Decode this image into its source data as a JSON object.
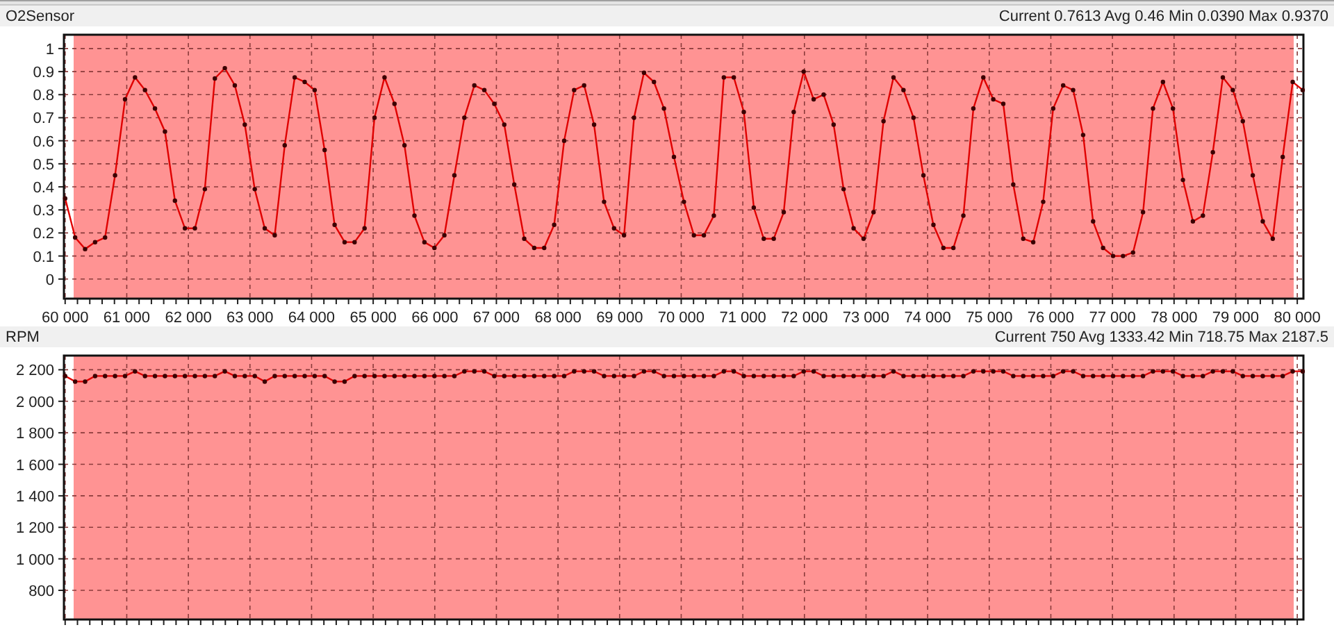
{
  "panels": [
    {
      "title": "O2Sensor",
      "stats": "Current 0.7613 Avg 0.46 Min 0.0390 Max 0.9370",
      "chart_data": {
        "type": "line",
        "grid": true,
        "x": [
          60000,
          60162,
          60324,
          60486,
          60648,
          60810,
          60972,
          61134,
          61296,
          61458,
          61620,
          61782,
          61944,
          62106,
          62268,
          62430,
          62592,
          62754,
          62916,
          63078,
          63240,
          63402,
          63564,
          63726,
          63888,
          64050,
          64212,
          64374,
          64536,
          64698,
          64860,
          65022,
          65184,
          65346,
          65508,
          65670,
          65832,
          65994,
          66156,
          66318,
          66480,
          66642,
          66804,
          66966,
          67128,
          67290,
          67452,
          67614,
          67776,
          67938,
          68100,
          68262,
          68424,
          68586,
          68748,
          68910,
          69072,
          69234,
          69396,
          69558,
          69720,
          69882,
          70044,
          70206,
          70368,
          70530,
          70692,
          70854,
          71016,
          71178,
          71340,
          71502,
          71664,
          71826,
          71988,
          72150,
          72312,
          72474,
          72636,
          72798,
          72960,
          73122,
          73284,
          73446,
          73608,
          73770,
          73932,
          74094,
          74256,
          74418,
          74580,
          74742,
          74904,
          75066,
          75228,
          75390,
          75552,
          75714,
          75876,
          76038,
          76200,
          76362,
          76524,
          76686,
          76848,
          77010,
          77172,
          77334,
          77496,
          77658,
          77820,
          77982,
          78144,
          78306,
          78468,
          78630,
          78792,
          78954,
          79116,
          79278,
          79440,
          79602,
          79764,
          79926,
          80088
        ],
        "series": [
          {
            "color": "#e00000",
            "marker": true,
            "values": [
              0.35,
              0.18,
              0.13,
              0.16,
              0.18,
              0.45,
              0.78,
              0.875,
              0.82,
              0.74,
              0.64,
              0.34,
              0.22,
              0.22,
              0.39,
              0.87,
              0.915,
              0.84,
              0.67,
              0.39,
              0.22,
              0.19,
              0.58,
              0.875,
              0.855,
              0.82,
              0.56,
              0.235,
              0.16,
              0.16,
              0.22,
              0.7,
              0.875,
              0.76,
              0.58,
              0.275,
              0.16,
              0.135,
              0.19,
              0.45,
              0.7,
              0.84,
              0.82,
              0.76,
              0.67,
              0.41,
              0.175,
              0.135,
              0.135,
              0.235,
              0.6,
              0.82,
              0.84,
              0.67,
              0.335,
              0.22,
              0.19,
              0.7,
              0.895,
              0.855,
              0.74,
              0.53,
              0.335,
              0.19,
              0.19,
              0.275,
              0.875,
              0.875,
              0.725,
              0.31,
              0.175,
              0.175,
              0.29,
              0.725,
              0.9,
              0.78,
              0.8,
              0.67,
              0.39,
              0.22,
              0.175,
              0.29,
              0.685,
              0.875,
              0.82,
              0.7,
              0.45,
              0.235,
              0.135,
              0.135,
              0.275,
              0.74,
              0.875,
              0.78,
              0.76,
              0.41,
              0.175,
              0.16,
              0.335,
              0.74,
              0.84,
              0.82,
              0.625,
              0.25,
              0.135,
              0.1,
              0.1,
              0.115,
              0.29,
              0.74,
              0.855,
              0.74,
              0.43,
              0.25,
              0.275,
              0.55,
              0.875,
              0.82,
              0.685,
              0.45,
              0.25,
              0.175,
              0.53,
              0.855,
              0.82
            ]
          }
        ],
        "xlim": [
          59980,
          80100
        ],
        "ylim": [
          -0.085,
          1.06
        ],
        "xticks": [
          {
            "value": 60000,
            "label": "60 000"
          },
          {
            "value": 61000,
            "label": "61 000"
          },
          {
            "value": 62000,
            "label": "62 000"
          },
          {
            "value": 63000,
            "label": "63 000"
          },
          {
            "value": 64000,
            "label": "64 000"
          },
          {
            "value": 65000,
            "label": "65 000"
          },
          {
            "value": 66000,
            "label": "66 000"
          },
          {
            "value": 67000,
            "label": "67 000"
          },
          {
            "value": 68000,
            "label": "68 000"
          },
          {
            "value": 69000,
            "label": "69 000"
          },
          {
            "value": 70000,
            "label": "70 000"
          },
          {
            "value": 71000,
            "label": "71 000"
          },
          {
            "value": 72000,
            "label": "72 000"
          },
          {
            "value": 73000,
            "label": "73 000"
          },
          {
            "value": 74000,
            "label": "74 000"
          },
          {
            "value": 75000,
            "label": "75 000"
          },
          {
            "value": 76000,
            "label": "76 000"
          },
          {
            "value": 77000,
            "label": "77 000"
          },
          {
            "value": 78000,
            "label": "78 000"
          },
          {
            "value": 79000,
            "label": "79 000"
          },
          {
            "value": 80000,
            "label": "80 000"
          }
        ],
        "yticks": [
          0,
          0.1,
          0.2,
          0.3,
          0.4,
          0.5,
          0.6,
          0.7,
          0.8,
          0.9,
          1
        ]
      }
    },
    {
      "title": "RPM",
      "stats": "Current 750 Avg 1333.42 Min 718.75 Max 2187.5",
      "chart_data": {
        "type": "line",
        "grid": true,
        "x": [
          60000,
          60162,
          60324,
          60486,
          60648,
          60810,
          60972,
          61134,
          61296,
          61458,
          61620,
          61782,
          61944,
          62106,
          62268,
          62430,
          62592,
          62754,
          62916,
          63078,
          63240,
          63402,
          63564,
          63726,
          63888,
          64050,
          64212,
          64374,
          64536,
          64698,
          64860,
          65022,
          65184,
          65346,
          65508,
          65670,
          65832,
          65994,
          66156,
          66318,
          66480,
          66642,
          66804,
          66966,
          67128,
          67290,
          67452,
          67614,
          67776,
          67938,
          68100,
          68262,
          68424,
          68586,
          68748,
          68910,
          69072,
          69234,
          69396,
          69558,
          69720,
          69882,
          70044,
          70206,
          70368,
          70530,
          70692,
          70854,
          71016,
          71178,
          71340,
          71502,
          71664,
          71826,
          71988,
          72150,
          72312,
          72474,
          72636,
          72798,
          72960,
          73122,
          73284,
          73446,
          73608,
          73770,
          73932,
          74094,
          74256,
          74418,
          74580,
          74742,
          74904,
          75066,
          75228,
          75390,
          75552,
          75714,
          75876,
          76038,
          76200,
          76362,
          76524,
          76686,
          76848,
          77010,
          77172,
          77334,
          77496,
          77658,
          77820,
          77982,
          78144,
          78306,
          78468,
          78630,
          78792,
          78954,
          79116,
          79278,
          79440,
          79602,
          79764,
          79926,
          80088
        ],
        "series": [
          {
            "color": "#e00000",
            "marker": true,
            "values": [
              2160,
              2125,
              2125,
              2160,
              2160,
              2160,
              2160,
              2190,
              2160,
              2160,
              2160,
              2160,
              2160,
              2160,
              2160,
              2160,
              2190,
              2160,
              2160,
              2160,
              2125,
              2160,
              2160,
              2160,
              2160,
              2160,
              2160,
              2125,
              2125,
              2160,
              2160,
              2160,
              2160,
              2160,
              2160,
              2160,
              2160,
              2160,
              2160,
              2160,
              2190,
              2190,
              2190,
              2160,
              2160,
              2160,
              2160,
              2160,
              2160,
              2160,
              2160,
              2190,
              2190,
              2190,
              2160,
              2160,
              2160,
              2160,
              2190,
              2190,
              2160,
              2160,
              2160,
              2160,
              2160,
              2160,
              2190,
              2190,
              2160,
              2160,
              2160,
              2160,
              2160,
              2160,
              2190,
              2190,
              2160,
              2160,
              2160,
              2160,
              2160,
              2160,
              2160,
              2190,
              2160,
              2160,
              2160,
              2160,
              2160,
              2160,
              2160,
              2190,
              2190,
              2190,
              2190,
              2160,
              2160,
              2160,
              2160,
              2160,
              2190,
              2190,
              2160,
              2160,
              2160,
              2160,
              2160,
              2160,
              2160,
              2190,
              2190,
              2190,
              2160,
              2160,
              2160,
              2190,
              2190,
              2190,
              2160,
              2160,
              2160,
              2160,
              2160,
              2190,
              2190
            ]
          }
        ],
        "xlim": [
          59980,
          80100
        ],
        "ylim": [
          615,
          2290
        ],
        "yticks": [
          {
            "value": 800,
            "label": "800"
          },
          {
            "value": 1000,
            "label": "1 000"
          },
          {
            "value": 1200,
            "label": "1 200"
          },
          {
            "value": 1400,
            "label": "1 400"
          },
          {
            "value": 1600,
            "label": "1 600"
          },
          {
            "value": 1800,
            "label": "1 800"
          },
          {
            "value": 2000,
            "label": "2 000"
          },
          {
            "value": 2200,
            "label": "2 200"
          }
        ]
      }
    }
  ]
}
